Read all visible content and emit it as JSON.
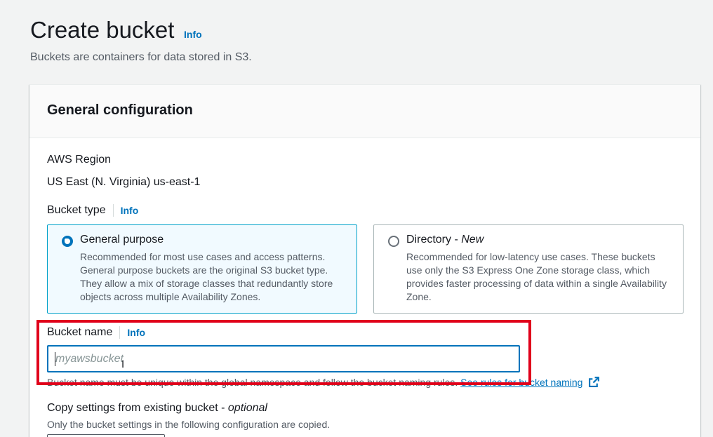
{
  "header": {
    "title": "Create bucket",
    "info": "Info",
    "subtitle": "Buckets are containers for data stored in S3."
  },
  "general_config": {
    "title": "General configuration",
    "region_label": "AWS Region",
    "region_value": "US East (N. Virginia) us-east-1",
    "bucket_type_label": "Bucket type",
    "bucket_type_info": "Info",
    "options": [
      {
        "title": "General purpose",
        "selected": true,
        "description": "Recommended for most use cases and access patterns. General purpose buckets are the original S3 bucket type. They allow a mix of storage classes that redundantly store objects across multiple Availability Zones."
      },
      {
        "title": "Directory - ",
        "title_suffix": "New",
        "selected": false,
        "description": "Recommended for low-latency use cases. These buckets use only the S3 Express One Zone storage class, which provides faster processing of data within a single Availability Zone."
      }
    ],
    "bucket_name_label": "Bucket name",
    "bucket_name_info": "Info",
    "bucket_name_value": "",
    "bucket_name_placeholder": "myawsbucket",
    "bucket_name_hint": "Bucket name must be unique within the global namespace and follow the bucket naming rules.",
    "bucket_name_hint_link": "See rules for bucket naming",
    "copy_label": "Copy settings from existing bucket - ",
    "copy_label_suffix": "optional",
    "copy_desc": "Only the bucket settings in the following configuration are copied."
  },
  "colors": {
    "accent": "#0073bb",
    "highlight": "#e0001b",
    "selected_card_bg": "#f1faff"
  },
  "icons": {
    "external_link": "external-link-icon"
  }
}
